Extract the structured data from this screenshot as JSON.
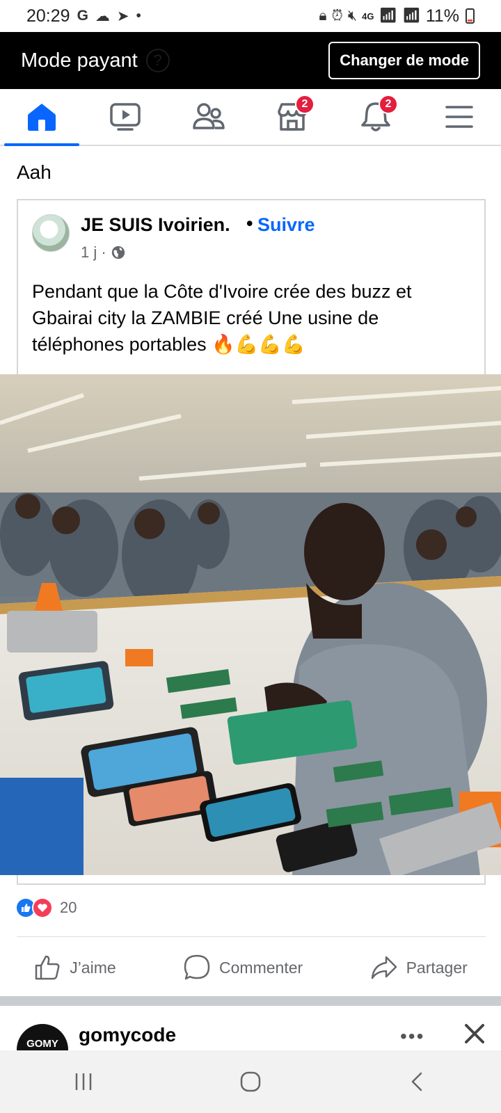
{
  "status_bar": {
    "time": "20:29",
    "left_icons": [
      "google-g-icon",
      "cloud-icon",
      "telegram-icon",
      "dot-icon"
    ],
    "right_icons": [
      "lock-icon",
      "alarm-icon",
      "mute-icon",
      "4g-icon",
      "signal-icon",
      "signal-icon"
    ],
    "network": "4G",
    "battery": "11%"
  },
  "mode_bar": {
    "title": "Mode payant",
    "help_icon": "?",
    "button_label": "Changer de mode"
  },
  "tabs": [
    {
      "name": "home",
      "icon": "home-icon",
      "active": true
    },
    {
      "name": "video",
      "icon": "video-icon",
      "active": false
    },
    {
      "name": "friends",
      "icon": "friends-icon",
      "active": false
    },
    {
      "name": "marketplace",
      "icon": "marketplace-icon",
      "active": false,
      "badge": "2"
    },
    {
      "name": "notifications",
      "icon": "bell-icon",
      "active": false,
      "badge": "2"
    },
    {
      "name": "menu",
      "icon": "menu-icon",
      "active": false
    }
  ],
  "post": {
    "caption": "Aah",
    "shared": {
      "author": "JE SUIS Ivoirien.",
      "separator": "•",
      "follow_label": "Suivre",
      "time": "1 j ·",
      "text": "Pendant que la Côte d'Ivoire crée des buzz et Gbairai city la ZAMBIE créé Une usine de téléphones portables 🔥💪💪💪"
    },
    "reactions_count": "20",
    "actions": {
      "like": "J’aime",
      "comment": "Commenter",
      "share": "Partager"
    }
  },
  "next_post": {
    "avatar_text": "GOMY",
    "author": "gomycode",
    "more_icon": "•••"
  },
  "colors": {
    "accent": "#0866ff",
    "badge": "#e41e3f",
    "mode_bar": "#000000"
  }
}
